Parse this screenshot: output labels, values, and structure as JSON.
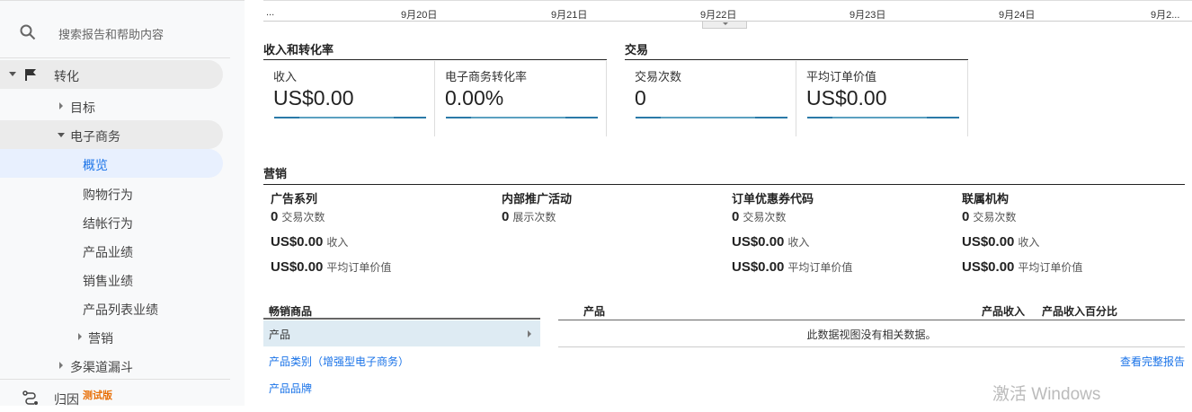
{
  "sidebar": {
    "search_placeholder": "搜索报告和帮助内容",
    "conversions": "转化",
    "goals": "目标",
    "ecommerce": "电子商务",
    "overview": "概览",
    "shopping_behavior": "购物行为",
    "checkout_behavior": "结帐行为",
    "product_performance": "产品业绩",
    "sales_performance": "销售业绩",
    "product_list_performance": "产品列表业绩",
    "marketing": "营销",
    "multichannel": "多渠道漏斗",
    "attribution": "归因",
    "beta": "测试版"
  },
  "timeline": {
    "labels": [
      "...",
      "9月20日",
      "9月21日",
      "9月22日",
      "9月23日",
      "9月24日",
      "9月2..."
    ]
  },
  "revenue_section": {
    "title": "收入和转化率",
    "cards": [
      {
        "label": "收入",
        "value": "US$0.00"
      },
      {
        "label": "电子商务转化率",
        "value": "0.00%"
      }
    ]
  },
  "transactions_section": {
    "title": "交易",
    "cards": [
      {
        "label": "交易次数",
        "value": "0"
      },
      {
        "label": "平均订单价值",
        "value": "US$0.00"
      }
    ]
  },
  "marketing": {
    "title": "营销",
    "columns": [
      {
        "title": "广告系列",
        "rows": [
          {
            "v": "0",
            "l": "交易次数"
          },
          {
            "v": "US$0.00",
            "l": "收入"
          },
          {
            "v": "US$0.00",
            "l": "平均订单价值"
          }
        ]
      },
      {
        "title": "内部推广活动",
        "rows": [
          {
            "v": "0",
            "l": "展示次数"
          }
        ]
      },
      {
        "title": "订单优惠券代码",
        "rows": [
          {
            "v": "0",
            "l": "交易次数"
          },
          {
            "v": "US$0.00",
            "l": "收入"
          },
          {
            "v": "US$0.00",
            "l": "平均订单价值"
          }
        ]
      },
      {
        "title": "联属机构",
        "rows": [
          {
            "v": "0",
            "l": "交易次数"
          },
          {
            "v": "US$0.00",
            "l": "收入"
          },
          {
            "v": "US$0.00",
            "l": "平均订单价值"
          }
        ]
      }
    ]
  },
  "top_sellers": {
    "title": "畅销商品",
    "items": [
      "产品",
      "产品类别（增强型电子商务）",
      "产品品牌"
    ],
    "table_headers": [
      "产品",
      "产品收入",
      "产品收入百分比"
    ],
    "empty": "此数据视图没有相关数据。",
    "full_report": "查看完整报告"
  },
  "watermark": "激活 Windows"
}
